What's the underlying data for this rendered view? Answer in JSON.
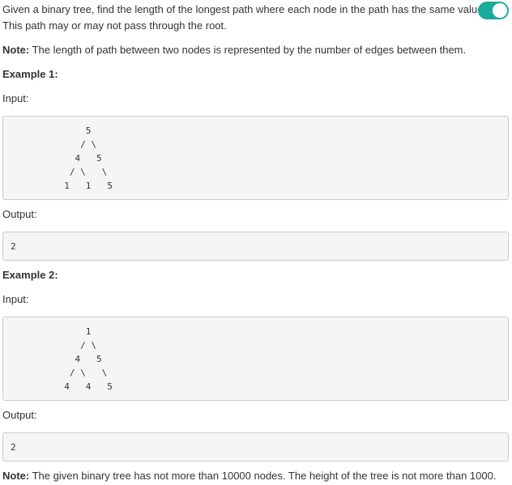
{
  "description": {
    "line1": "Given a binary tree, find the length of the longest path where each node in the path has the same value.",
    "line2": "This path may or may not pass through the root."
  },
  "toggle": {
    "state": "on",
    "color": "#1aaa9c"
  },
  "note1": {
    "label": "Note:",
    "text": " The length of path between two nodes is represented by the number of edges between them."
  },
  "example1": {
    "title": "Example 1:",
    "input_label": "Input:",
    "input_tree": "              5\n             / \\\n            4   5\n           / \\   \\\n          1   1   5",
    "output_label": "Output:",
    "output_value": "2"
  },
  "example2": {
    "title": "Example 2:",
    "input_label": "Input:",
    "input_tree": "              1\n             / \\\n            4   5\n           / \\   \\\n          4   4   5",
    "output_label": "Output:",
    "output_value": "2"
  },
  "note2": {
    "label": "Note:",
    "text": " The given binary tree has not more than 10000 nodes. The height of the tree is not more than 1000."
  }
}
